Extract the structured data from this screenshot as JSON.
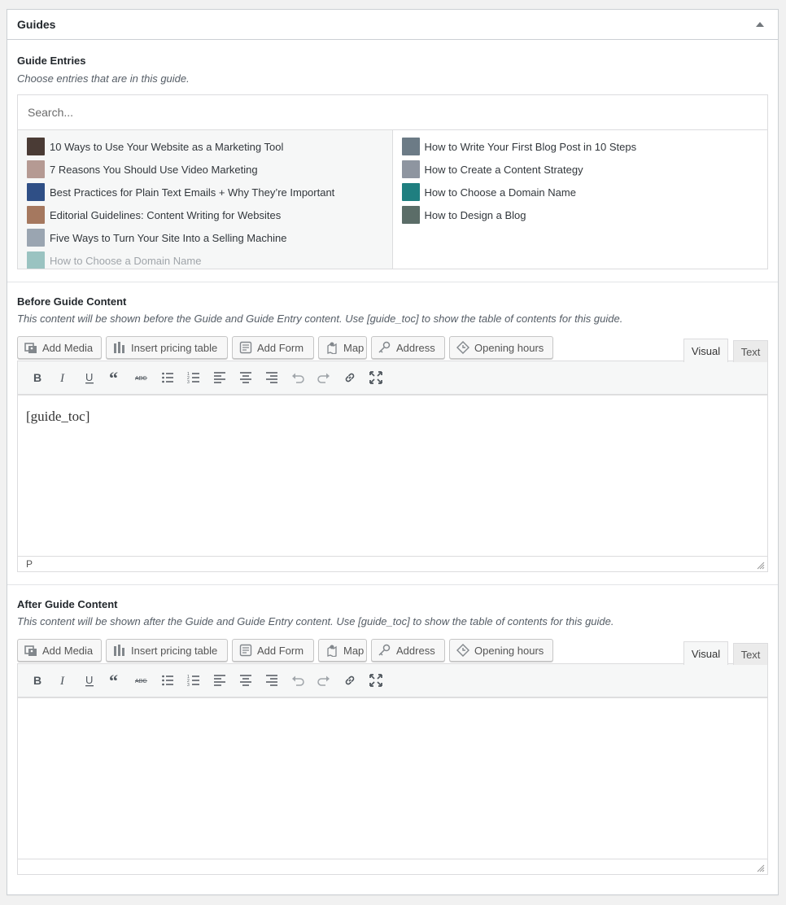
{
  "panel": {
    "title": "Guides"
  },
  "entries": {
    "label": "Guide Entries",
    "description": "Choose entries that are in this guide.",
    "search_placeholder": "Search...",
    "choices": [
      {
        "title": "10 Ways to Use Your Website as a Marketing Tool",
        "thumb": "#4a3b35",
        "disabled": false
      },
      {
        "title": "7 Reasons You Should Use Video Marketing",
        "thumb": "#b59a93",
        "disabled": false
      },
      {
        "title": "Best Practices for Plain Text Emails + Why They’re Important",
        "thumb": "#2f4f86",
        "disabled": false
      },
      {
        "title": "Editorial Guidelines: Content Writing for Websites",
        "thumb": "#a5785f",
        "disabled": false
      },
      {
        "title": "Five Ways to Turn Your Site Into a Selling Machine",
        "thumb": "#9aa5b1",
        "disabled": false
      },
      {
        "title": "How to Choose a Domain Name",
        "thumb": "#3d8f8c",
        "disabled": true
      }
    ],
    "selected": [
      {
        "title": "How to Write Your First Blog Post in 10 Steps",
        "thumb": "#6c7b86"
      },
      {
        "title": "How to Create a Content Strategy",
        "thumb": "#8e95a0"
      },
      {
        "title": "How to Choose a Domain Name",
        "thumb": "#1f7f80"
      },
      {
        "title": "How to Design a Blog",
        "thumb": "#5b6d68"
      }
    ]
  },
  "before": {
    "label": "Before Guide Content",
    "description": "This content will be shown before the Guide and Guide Entry content. Use [guide_toc] to show the table of contents for this guide.",
    "content": "[guide_toc]",
    "path": "P"
  },
  "after": {
    "label": "After Guide Content",
    "description": "This content will be shown after the Guide and Guide Entry content. Use [guide_toc] to show the table of contents for this guide.",
    "content": "",
    "path": ""
  },
  "editor_buttons": {
    "add_media": "Add Media",
    "pricing": "Insert pricing table",
    "add_form": "Add Form",
    "map": "Map",
    "address": "Address",
    "hours": "Opening hours",
    "tab_visual": "Visual",
    "tab_text": "Text"
  },
  "toolbar_icons": [
    "bold-icon",
    "italic-icon",
    "underline-icon",
    "blockquote-icon",
    "strikethrough-icon",
    "bullet-list-icon",
    "numbered-list-icon",
    "align-left-icon",
    "align-center-icon",
    "align-right-icon",
    "undo-icon",
    "redo-icon",
    "link-icon",
    "fullscreen-icon"
  ]
}
